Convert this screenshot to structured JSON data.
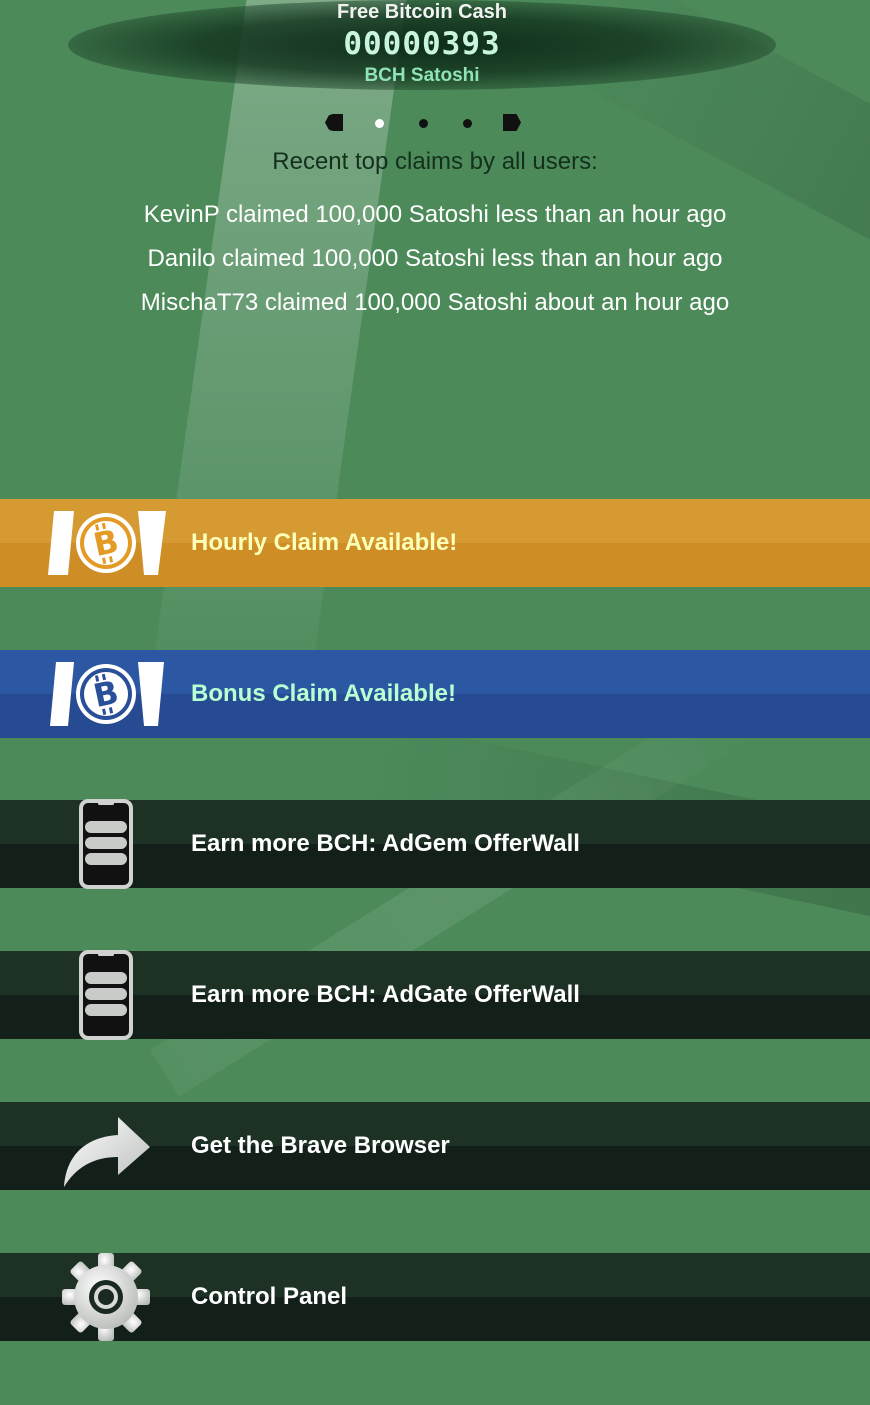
{
  "header": {
    "title": "Free Bitcoin Cash",
    "balance": "00000393",
    "unit": "BCH Satoshi"
  },
  "pager": {
    "pages": 3,
    "active_index": 0
  },
  "recent": {
    "title": "Recent top claims by all users:",
    "claims": [
      "KevinP claimed 100,000 Satoshi less than an hour ago",
      "Danilo claimed 100,000 Satoshi less than an hour ago",
      "MischaT73 claimed 100,000 Satoshi about an hour ago"
    ]
  },
  "actions": {
    "hourly": {
      "label": "Hourly Claim Available!",
      "icon": "bitcoin-cash-icon"
    },
    "bonus": {
      "label": "Bonus Claim Available!",
      "icon": "bitcoin-cash-icon"
    },
    "adgem": {
      "label": "Earn more BCH: AdGem OfferWall",
      "icon": "phone-list-icon"
    },
    "adgate": {
      "label": "Earn more BCH: AdGate OfferWall",
      "icon": "phone-list-icon"
    },
    "brave": {
      "label": "Get the Brave Browser",
      "icon": "share-arrow-icon"
    },
    "control": {
      "label": "Control Panel",
      "icon": "gear-icon"
    }
  },
  "colors": {
    "background": "#4c8a5a",
    "hourly_bar": "#d59a32",
    "bonus_bar": "#2c58a3",
    "dark_bar": "#1d3124",
    "balance_text": "#c9f5df",
    "unit_text": "#90e3b7",
    "hourly_text": "#fbffb8",
    "bonus_text": "#b8ffd2"
  }
}
